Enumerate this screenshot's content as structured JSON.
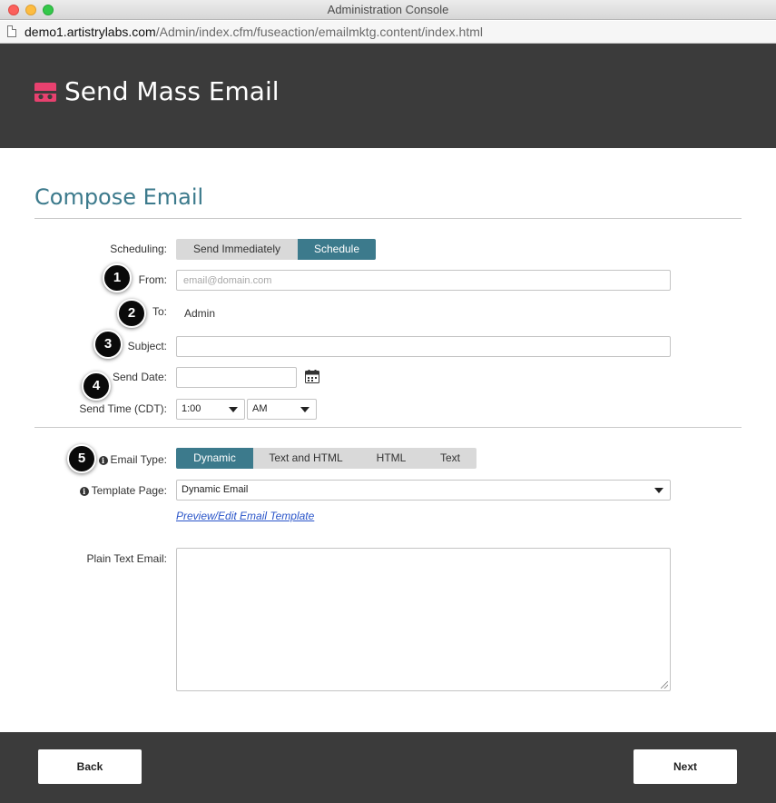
{
  "window": {
    "title": "Administration Console"
  },
  "browser": {
    "url_host": "demo1.artistrylabs.com",
    "url_path": "/Admin/index.cfm/fuseaction/emailmktg.content/index.html"
  },
  "header": {
    "title": "Send Mass Email",
    "logo_color": "#e8416f"
  },
  "page": {
    "title": "Compose Email",
    "accent": "#3c7a8c"
  },
  "form": {
    "scheduling": {
      "label": "Scheduling:",
      "options": [
        "Send Immediately",
        "Schedule"
      ],
      "selected": "Schedule"
    },
    "from": {
      "label": "From:",
      "placeholder": "email@domain.com",
      "value": ""
    },
    "to": {
      "label": "To:",
      "value": "Admin"
    },
    "subject": {
      "label": "Subject:",
      "value": ""
    },
    "send_date": {
      "label": "Send Date:",
      "value": "",
      "icon": "calendar-icon"
    },
    "send_time": {
      "label": "Send Time (CDT):",
      "hour": "1:00",
      "ampm": "AM"
    },
    "email_type": {
      "label": "Email Type:",
      "options": [
        "Dynamic",
        "Text and HTML",
        "HTML",
        "Text"
      ],
      "selected": "Dynamic"
    },
    "template_page": {
      "label": "Template Page:",
      "value": "Dynamic Email"
    },
    "preview_link": "Preview/Edit Email Template",
    "plain_text": {
      "label": "Plain Text Email:",
      "value": ""
    }
  },
  "badges": [
    "1",
    "2",
    "3",
    "4",
    "5"
  ],
  "footer": {
    "back_label": "Back",
    "next_label": "Next"
  }
}
